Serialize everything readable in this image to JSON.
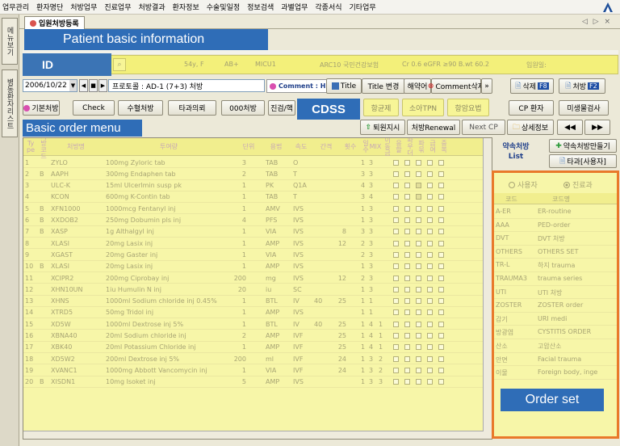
{
  "menubar": {
    "items": [
      "업무관리",
      "환자명단",
      "처방업무",
      "진료업무",
      "처방결과",
      "환자정보",
      "수술및일정",
      "정보검색",
      "과별업무",
      "각종서식",
      "기타업무"
    ]
  },
  "colors": {
    "annotation_blue": "#2f6db7",
    "annotation_orange": "#e9792a",
    "highlight_yellow": "#f3f07a"
  },
  "sidebar": {
    "tabs": [
      "메뉴보기",
      "병동환자리스트"
    ]
  },
  "document_tab": {
    "label": "입원처방등록"
  },
  "tab_nav": "◁ ▷ ×",
  "annotations": {
    "patient_info": "Patient basic information",
    "id": "ID",
    "cdss": "CDSS",
    "basic_order_menu": "Basic order menu",
    "order_set": "Order set"
  },
  "id_bar": {
    "age_sex": "54y, F",
    "blood": "AB+",
    "ward": "MICU1",
    "insurance": "ARC10  국민건강보험",
    "labs": "Cr 0.6  eGFR ≥90  B.wt 60.2",
    "admit_date_label": "입원일:"
  },
  "order_bar": {
    "date": "2006/10/22",
    "protocol": "프로토콜 : AD-1 (7+3) 처방",
    "comment_label": "Comment : HN",
    "title_btn": "Title",
    "title_change_btn": "Title 변경",
    "drug_hist_btn": "해약어",
    "comment_delete_btn": "Comment삭제",
    "delete_btn": "삭제",
    "delete_key": "F8",
    "prescribe_btn": "처방",
    "prescribe_key": "F2"
  },
  "order_menu": {
    "buttons": [
      "기본처방",
      "Check",
      "수혈처방",
      "타과의뢰",
      "000처방",
      "진검/핵"
    ]
  },
  "cdss": {
    "buttons": [
      "항균제",
      "소아TPN",
      "항암요법"
    ]
  },
  "order_menu_right": {
    "cp_patient": "CP 환자",
    "micro_test": "미생물검사",
    "discharge": "퇴원지시",
    "renewal": "처방Renewal",
    "next_cp": "Next CP",
    "detail": "상세정보",
    "prev": "◀◀",
    "next": "▶▶"
  },
  "grid": {
    "headers": [
      "Ty pe",
      "처방코드",
      "처방명",
      "투여량",
      "단위",
      "용법",
      "속도",
      "간격",
      "횟수",
      "일수",
      "MIX",
      "이동금",
      "응할",
      "파우더",
      "파묶",
      "급여",
      "중복"
    ],
    "rows": [
      {
        "n": "1",
        "t": "",
        "code": "ZYLO",
        "name": "100mg Zyloric tab",
        "dose": "3",
        "unit": "TAB",
        "usage": "O",
        "speed": "",
        "intv": "",
        "f": "1",
        "d": "3",
        "c": [
          0,
          0,
          0,
          0,
          0
        ]
      },
      {
        "n": "2",
        "t": "B",
        "code": "AAPH",
        "name": "300mg Endaphen tab",
        "dose": "2",
        "unit": "TAB",
        "usage": "T",
        "speed": "",
        "intv": "",
        "f": "3",
        "d": "3",
        "c": [
          0,
          0,
          0,
          0,
          0
        ]
      },
      {
        "n": "3",
        "t": "",
        "code": "ULC-K",
        "name": "15ml Ulcerlmin susp pk",
        "dose": "1",
        "unit": "PK",
        "usage": "Q1A",
        "speed": "",
        "intv": "",
        "f": "4",
        "d": "3",
        "c": [
          0,
          0,
          1,
          0,
          0
        ]
      },
      {
        "n": "4",
        "t": "",
        "code": "KCON",
        "name": "600mg K-Contin tab",
        "dose": "1",
        "unit": "TAB",
        "usage": "T",
        "speed": "",
        "intv": "",
        "f": "3",
        "d": "4",
        "c": [
          0,
          0,
          1,
          0,
          0
        ]
      },
      {
        "n": "5",
        "t": "B",
        "code": "XFN1000",
        "name": "1000mcg Fentanyl inj",
        "dose": "1",
        "unit": "AMV",
        "usage": "IVS",
        "speed": "",
        "intv": "",
        "f": "1",
        "d": "3",
        "c": [
          0,
          0,
          0,
          0,
          0
        ]
      },
      {
        "n": "6",
        "t": "B",
        "code": "XXDOB2",
        "name": "250mg Dobumin pls inj",
        "dose": "4",
        "unit": "PFS",
        "usage": "IVS",
        "speed": "",
        "intv": "",
        "f": "1",
        "d": "3",
        "c": [
          0,
          0,
          0,
          0,
          0
        ]
      },
      {
        "n": "7",
        "t": "B",
        "code": "XASP",
        "name": "1g Althalgyl inj",
        "dose": "1",
        "unit": "VIA",
        "usage": "IVS",
        "speed": "",
        "intv": "8",
        "f": "3",
        "d": "3",
        "c": [
          0,
          0,
          0,
          0,
          0
        ]
      },
      {
        "n": "8",
        "t": "",
        "code": "XLASI",
        "name": "20mg Lasix inj",
        "dose": "1",
        "unit": "AMP",
        "usage": "IVS",
        "speed": "",
        "intv": "12",
        "f": "2",
        "d": "3",
        "c": [
          0,
          0,
          0,
          0,
          0
        ]
      },
      {
        "n": "9",
        "t": "",
        "code": "XGAST",
        "name": "20mg Gaster inj",
        "dose": "1",
        "unit": "VIA",
        "usage": "IVS",
        "speed": "",
        "intv": "",
        "f": "2",
        "d": "3",
        "c": [
          0,
          0,
          0,
          0,
          0
        ]
      },
      {
        "n": "10",
        "t": "B",
        "code": "XLASI",
        "name": "20mg Lasix inj",
        "dose": "1",
        "unit": "AMP",
        "usage": "IVS",
        "speed": "",
        "intv": "",
        "f": "1",
        "d": "3",
        "c": [
          0,
          0,
          0,
          0,
          0
        ]
      },
      {
        "n": "11",
        "t": "",
        "code": "XCIPR2",
        "name": "200mg Ciprobay inj",
        "dose": "200",
        "unit": "mg",
        "usage": "IVS",
        "speed": "",
        "intv": "12",
        "f": "2",
        "d": "3",
        "c": [
          0,
          0,
          0,
          0,
          0
        ]
      },
      {
        "n": "12",
        "t": "",
        "code": "XHN10UN",
        "name": "1iu Humulin N inj",
        "dose": "20",
        "unit": "iu",
        "usage": "SC",
        "speed": "",
        "intv": "",
        "f": "1",
        "d": "3",
        "c": [
          0,
          0,
          0,
          0,
          0
        ]
      },
      {
        "n": "13",
        "t": "",
        "code": "XHNS",
        "name": "1000ml Sodium chloride inj 0.45%",
        "dose": "1",
        "unit": "BTL",
        "usage": "IV",
        "speed": "40",
        "intv": "25",
        "f": "1",
        "d": "1",
        "c": [
          0,
          0,
          0,
          0,
          0
        ]
      },
      {
        "n": "14",
        "t": "",
        "code": "XTRD5",
        "name": "50mg Tridol inj",
        "dose": "1",
        "unit": "AMP",
        "usage": "IVS",
        "speed": "",
        "intv": "",
        "f": "1",
        "d": "1",
        "c": [
          0,
          0,
          0,
          0,
          0
        ]
      },
      {
        "n": "15",
        "t": "",
        "code": "XD5W",
        "name": "1000ml Dextrose inj 5%",
        "dose": "1",
        "unit": "BTL",
        "usage": "IV",
        "speed": "40",
        "intv": "25",
        "f": "1",
        "d": "4",
        "m": "1",
        "c": [
          0,
          0,
          0,
          0,
          0
        ]
      },
      {
        "n": "16",
        "t": "",
        "code": "XBNA40",
        "name": "20ml Sodium chloride inj",
        "dose": "2",
        "unit": "AMP",
        "usage": "IVF",
        "speed": "",
        "intv": "25",
        "f": "1",
        "d": "4",
        "m": "1",
        "c": [
          0,
          0,
          0,
          0,
          0
        ]
      },
      {
        "n": "17",
        "t": "",
        "code": "XBK40",
        "name": "20ml Potassium Chloride inj",
        "dose": "1",
        "unit": "AMP",
        "usage": "IVF",
        "speed": "",
        "intv": "25",
        "f": "1",
        "d": "4",
        "m": "1",
        "c": [
          0,
          0,
          0,
          0,
          0
        ]
      },
      {
        "n": "18",
        "t": "",
        "code": "XD5W2",
        "name": "200ml Dextrose inj 5%",
        "dose": "200",
        "unit": "ml",
        "usage": "IVF",
        "speed": "",
        "intv": "24",
        "f": "1",
        "d": "3",
        "m": "2",
        "c": [
          0,
          0,
          0,
          0,
          0
        ]
      },
      {
        "n": "19",
        "t": "",
        "code": "XVANC1",
        "name": "1000mg Abbott Vancomycin inj",
        "dose": "1",
        "unit": "VIA",
        "usage": "IVF",
        "speed": "",
        "intv": "24",
        "f": "1",
        "d": "3",
        "m": "2",
        "c": [
          0,
          0,
          0,
          0,
          0
        ]
      },
      {
        "n": "20",
        "t": "B",
        "code": "XISDN1",
        "name": "10mg Isoket inj",
        "dose": "5",
        "unit": "AMP",
        "usage": "IVS",
        "speed": "",
        "intv": "",
        "f": "1",
        "d": "3",
        "m": "3",
        "c": [
          0,
          0,
          0,
          0,
          0
        ]
      }
    ]
  },
  "right_panel": {
    "favorites_label": "약속처방\nList",
    "favorites_make": "약속처방만들기",
    "other_dept": "타과[사용자]",
    "radio_user": "사용자",
    "radio_dept": "진료과",
    "col_code": "코드",
    "col_name": "코드명",
    "sets": [
      {
        "code": "A-ER",
        "name": "ER-routine"
      },
      {
        "code": "AAA",
        "name": "PED-order"
      },
      {
        "code": "DVT",
        "name": "DVT 처방"
      },
      {
        "code": "OTHERS",
        "name": "OTHERS SET"
      },
      {
        "code": "TR-L",
        "name": "하지 trauma"
      },
      {
        "code": "TRAUMA3",
        "name": "trauma series"
      },
      {
        "code": "UTI",
        "name": "UTI 처방"
      },
      {
        "code": "ZOSTER",
        "name": "ZOSTER order"
      },
      {
        "code": "감기",
        "name": "URI medi"
      },
      {
        "code": "방광염",
        "name": "CYSTITIS ORDER"
      },
      {
        "code": "산소",
        "name": "고압산소"
      },
      {
        "code": "안면",
        "name": "Facial trauma"
      },
      {
        "code": "이물",
        "name": "Foreign body, inge"
      }
    ]
  }
}
